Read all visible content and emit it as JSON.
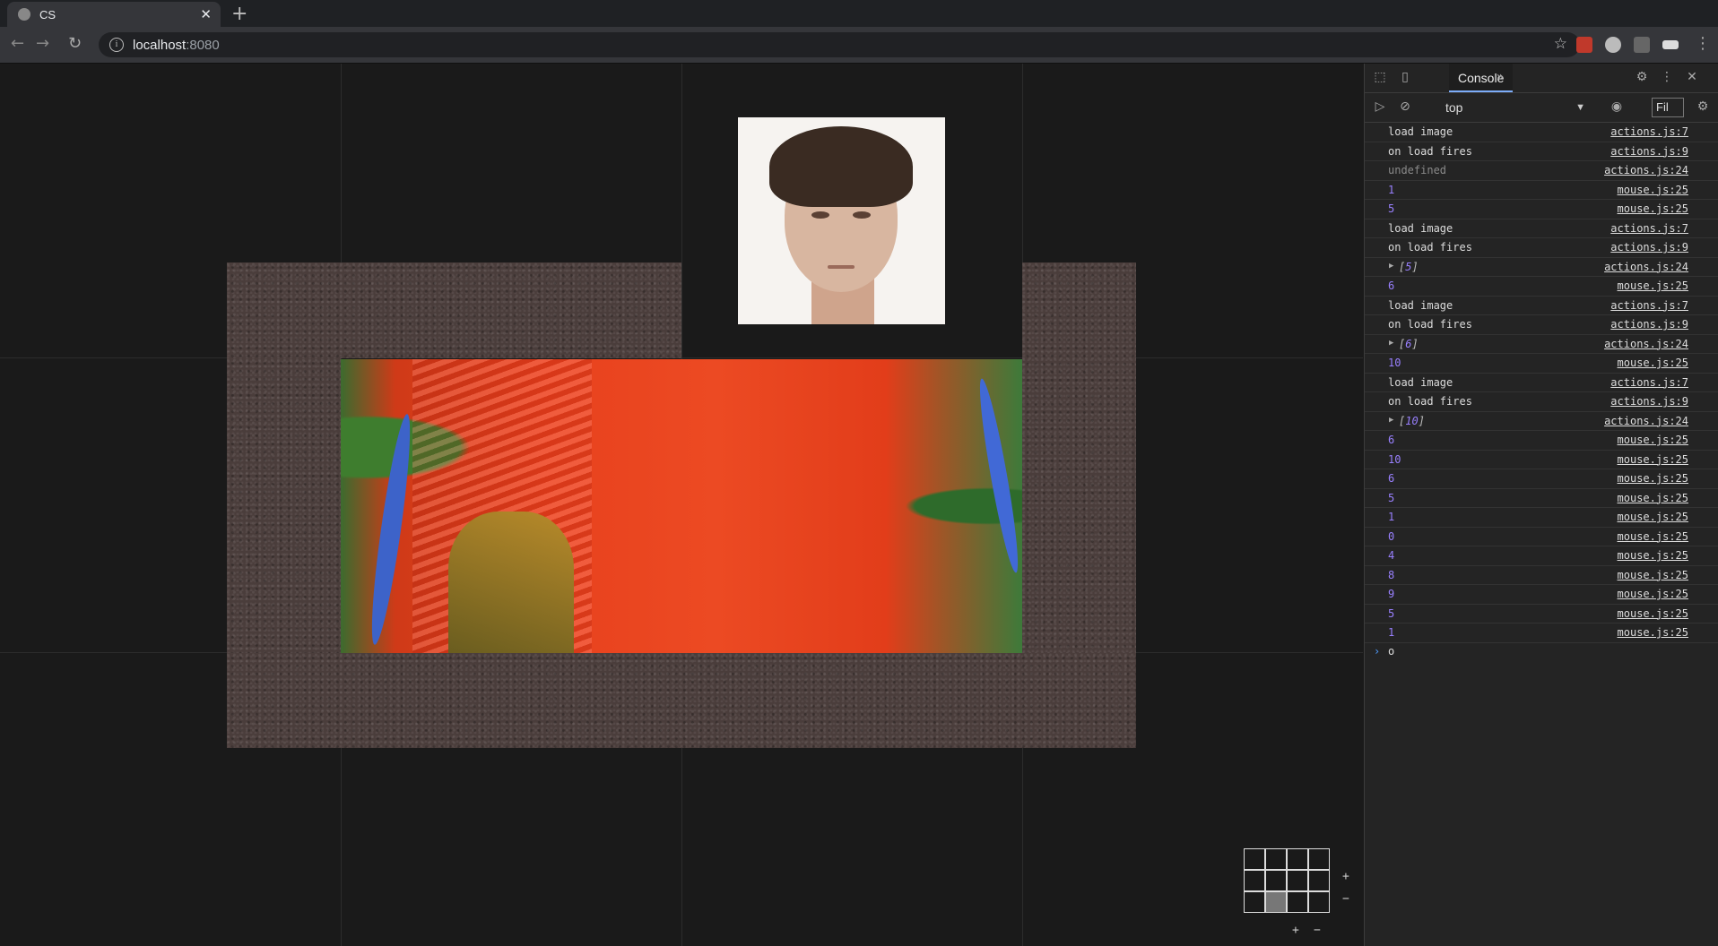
{
  "browser": {
    "tab_title": "CS",
    "close_glyph": "✕",
    "new_tab_glyph": "+",
    "url_host": "localhost",
    "url_port": ":8080",
    "back_glyph": "←",
    "forward_glyph": "→",
    "reload_glyph": "↻",
    "star_glyph": "☆"
  },
  "page": {
    "minimap": {
      "active_cell_row": 2,
      "active_cell_col": 1
    },
    "zoom_side_plus": "+",
    "zoom_side_minus": "−",
    "zoom_bottom_plus": "+",
    "zoom_bottom_minus": "−"
  },
  "devtools": {
    "active_tab": "Console",
    "more_tabs": "»",
    "context": "top",
    "filter_text": "Fil",
    "prompt_text": "o",
    "log": [
      {
        "kind": "text",
        "message": "load image",
        "source": "actions.js:7"
      },
      {
        "kind": "text",
        "message": "on load fires",
        "source": "actions.js:9"
      },
      {
        "kind": "undef",
        "message": "undefined",
        "source": "actions.js:24"
      },
      {
        "kind": "num",
        "message": "1",
        "source": "mouse.js:25"
      },
      {
        "kind": "num",
        "message": "5",
        "source": "mouse.js:25"
      },
      {
        "kind": "text",
        "message": "load image",
        "source": "actions.js:7"
      },
      {
        "kind": "text",
        "message": "on load fires",
        "source": "actions.js:9"
      },
      {
        "kind": "arr",
        "message": "5",
        "source": "actions.js:24"
      },
      {
        "kind": "num",
        "message": "6",
        "source": "mouse.js:25"
      },
      {
        "kind": "text",
        "message": "load image",
        "source": "actions.js:7"
      },
      {
        "kind": "text",
        "message": "on load fires",
        "source": "actions.js:9"
      },
      {
        "kind": "arr",
        "message": "6",
        "source": "actions.js:24"
      },
      {
        "kind": "num",
        "message": "10",
        "source": "mouse.js:25"
      },
      {
        "kind": "text",
        "message": "load image",
        "source": "actions.js:7"
      },
      {
        "kind": "text",
        "message": "on load fires",
        "source": "actions.js:9"
      },
      {
        "kind": "arr",
        "message": "10",
        "source": "actions.js:24"
      },
      {
        "kind": "num",
        "message": "6",
        "source": "mouse.js:25"
      },
      {
        "kind": "num",
        "message": "10",
        "source": "mouse.js:25"
      },
      {
        "kind": "num",
        "message": "6",
        "source": "mouse.js:25"
      },
      {
        "kind": "num",
        "message": "5",
        "source": "mouse.js:25"
      },
      {
        "kind": "num",
        "message": "1",
        "source": "mouse.js:25"
      },
      {
        "kind": "num",
        "message": "0",
        "source": "mouse.js:25"
      },
      {
        "kind": "num",
        "message": "4",
        "source": "mouse.js:25"
      },
      {
        "kind": "num",
        "message": "8",
        "source": "mouse.js:25"
      },
      {
        "kind": "num",
        "message": "9",
        "source": "mouse.js:25"
      },
      {
        "kind": "num",
        "message": "5",
        "source": "mouse.js:25"
      },
      {
        "kind": "num",
        "message": "1",
        "source": "mouse.js:25"
      }
    ]
  }
}
